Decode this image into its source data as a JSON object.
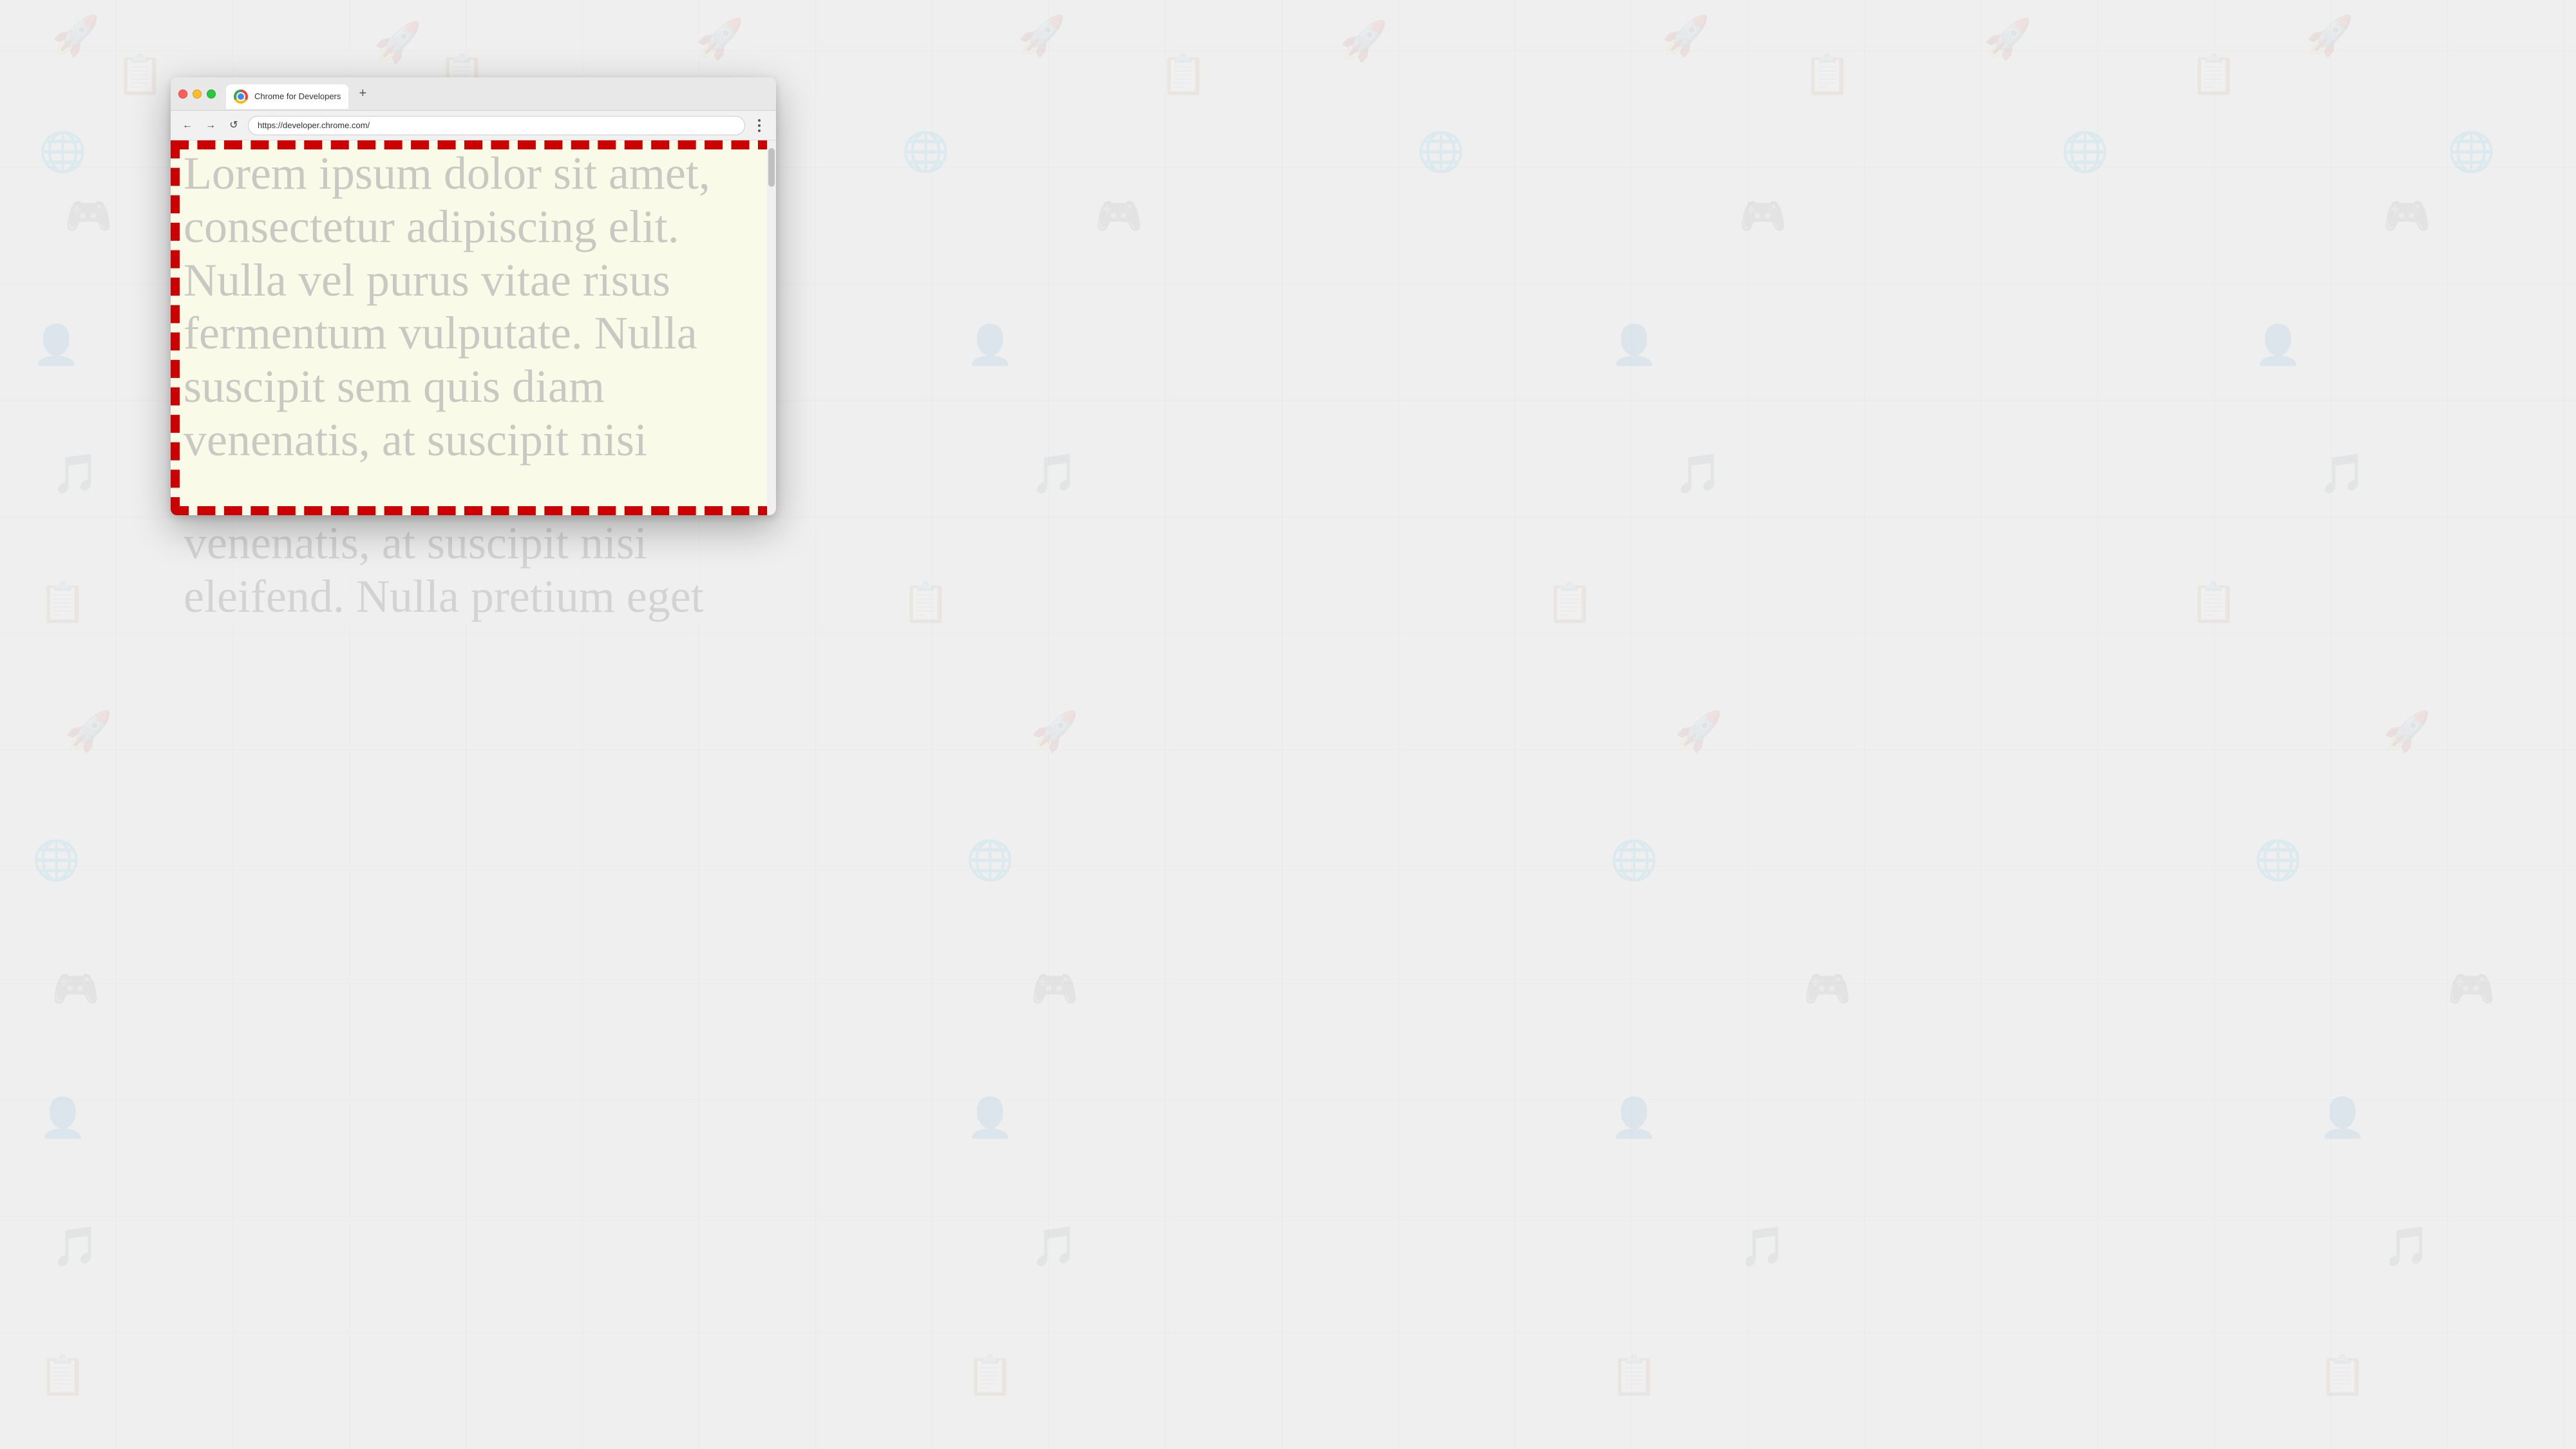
{
  "background": {
    "color": "#efefef"
  },
  "browser": {
    "tab": {
      "title": "Chrome for Developers",
      "favicon": "chrome-logo"
    },
    "new_tab_label": "+",
    "address": "https://developer.chrome.com/",
    "menu_label": "⋮"
  },
  "nav": {
    "back_label": "←",
    "forward_label": "→",
    "reload_label": "↺"
  },
  "page": {
    "lorem_text_1": "Lorem ipsum dolor sit amet,",
    "lorem_text_2": "consectetur adipiscing elit.",
    "lorem_text_3": "Nulla vel purus vitae risus",
    "lorem_text_4": "fermentum vulputate. Nulla",
    "lorem_text_5": "suscipit sem quis diam",
    "lorem_text_6": "venenatis, at suscipit nisi",
    "lorem_text_7": "eleifend. Nulla pretium eget"
  }
}
